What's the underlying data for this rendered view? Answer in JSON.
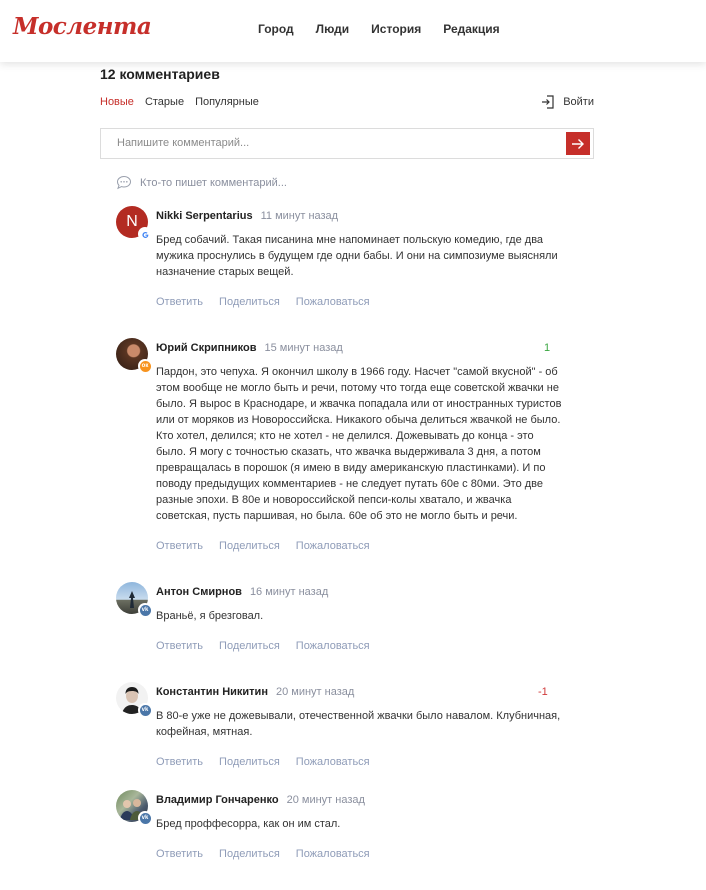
{
  "header": {
    "logo": "Мослента",
    "nav": [
      "Город",
      "Люди",
      "История",
      "Редакция"
    ]
  },
  "comments_section": {
    "title": "12 комментариев",
    "sort": [
      "Новые",
      "Старые",
      "Популярные"
    ],
    "active_sort": "Новые",
    "login_label": "Войти",
    "input_placeholder": "Напишите комментарий...",
    "typing_text": "Кто-то пишет комментарий...",
    "colors": {
      "accent": "#c62f2a",
      "positive": "#3aa641",
      "negative": "#d0393a"
    }
  },
  "actions": {
    "reply": "Ответить",
    "share": "Поделиться",
    "report": "Пожаловаться"
  },
  "comments": [
    {
      "author": "Nikki Serpentarius",
      "time": "11 минут назад",
      "rating": "",
      "avatar_letter": "N",
      "network": "google-icon",
      "text": "Бред собачий. Такая писанина мне напоминает польскую комедию, где два мужика проснулись в будущем где одни бабы. И они на симпозиуме выясняли назначение старых вещей."
    },
    {
      "author": "Юрий Скрипников",
      "time": "15 минут назад",
      "rating": "1",
      "avatar_letter": "",
      "network": "odnoklassniki-icon",
      "text": "Пардон, это чепуха. Я окончил школу в 1966 году. Насчет \"самой вкусной\" - об этом вообще не могло быть и речи, потому что тогда еще советской жвачки не было. Я вырос в Краснодаре, и жвачка попадала или от иностранных туристов или от моряков из Новороссийска. Никакого обыча делиться жвачкой не было. Кто хотел, делился; кто не хотел - не делился. Дожевывать до конца - это было. Я могу с точностью сказать, что жвачка выдерживала 3 дня, а потом превращалась в порошок (я имею в виду американскую пластинками). И по поводу предыдущих комментариев - не следует путать 60е с 80ми. Это две разные эпохи. В 80е и новороссийской пепси-колы хватало, и жвачка советская, пусть паршивая, но была. 60е об это не могло быть и речи."
    },
    {
      "author": "Антон Смирнов",
      "time": "16 минут назад",
      "rating": "",
      "avatar_letter": "",
      "network": "vk-icon",
      "text": "Враньё, я брезговал."
    },
    {
      "author": "Константин Никитин",
      "time": "20 минут назад",
      "rating": "-1",
      "avatar_letter": "",
      "network": "vk-icon",
      "text": "В 80-е уже не дожевывали, отечественной жвачки было навалом. Клубничная, кофейная, мятная."
    },
    {
      "author": "Владимир Гончаренко",
      "time": "20 минут назад",
      "rating": "",
      "avatar_letter": "",
      "network": "vk-icon",
      "text": "Бред проффесорра, как он им стал."
    }
  ]
}
